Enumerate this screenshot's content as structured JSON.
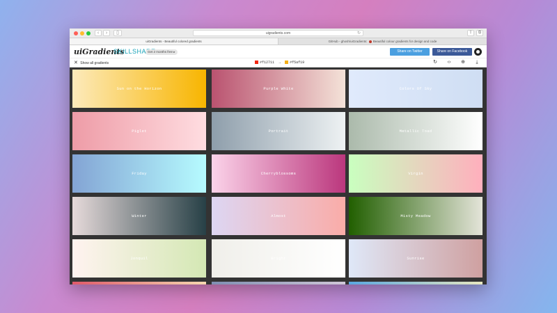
{
  "browser": {
    "url": "uigradients.com",
    "tabs": [
      {
        "label": "uiGradients - Beautiful colored gradients",
        "active": true
      },
      {
        "label_pre": "GitHub - ghosh/uiGradients:",
        "label_post": "Beautiful colour gradients for design and code",
        "active": false
      }
    ]
  },
  "header": {
    "logo": "uiGradients",
    "separator": "▸",
    "sponsor": "SKILLSHARE",
    "promo": "Get 2 months free ▸",
    "share_twitter": "Share on Twitter",
    "share_facebook": "Share on Facebook"
  },
  "toolbar": {
    "show_all": "Show all gradients",
    "color_from": "#f12711",
    "color_to": "#f5af19",
    "arrow": "→"
  },
  "gradients": [
    {
      "name": "Sun on the Horizon",
      "from": "#fceabb",
      "to": "#f8b500"
    },
    {
      "name": "Purple White",
      "from": "#ba5370",
      "to": "#f4e2d8"
    },
    {
      "name": "Colors Of Sky",
      "from": "#e0eafc",
      "to": "#cfdef3"
    },
    {
      "name": "Piglet",
      "from": "#ee9ca7",
      "to": "#ffdde1"
    },
    {
      "name": "Portrait",
      "from": "#8e9eab",
      "to": "#eef2f3"
    },
    {
      "name": "Metallic Toad",
      "from": "#abbaab",
      "to": "#ffffff"
    },
    {
      "name": "Friday",
      "from": "#83a4d4",
      "to": "#b6fbff"
    },
    {
      "name": "Cherryblossoms",
      "from": "#fbd3e9",
      "to": "#bb377d"
    },
    {
      "name": "Virgin",
      "from": "#c9ffbf",
      "to": "#ffafbd"
    },
    {
      "name": "Winter",
      "from": "#e6dada",
      "to": "#274046"
    },
    {
      "name": "Almost",
      "from": "#ddd6f3",
      "to": "#faaca8"
    },
    {
      "name": "Misty Meadow",
      "from": "#215f00",
      "to": "#e4e4d9"
    },
    {
      "name": "Jonquil",
      "from": "#fff3f0",
      "to": "#d4e8b4"
    },
    {
      "name": "Bright",
      "from": "#f0efea",
      "to": "#ffffff"
    },
    {
      "name": "Sunrise",
      "from": "#dfe8f8",
      "to": "#cfa0a0"
    },
    {
      "name": "",
      "from": "#e05a6a",
      "to": "#f5d8b0"
    },
    {
      "name": "",
      "from": "#7f8fb2",
      "to": "#d0c8d8"
    },
    {
      "name": "",
      "from": "#5aa8e0",
      "to": "#e8e8c0"
    }
  ]
}
